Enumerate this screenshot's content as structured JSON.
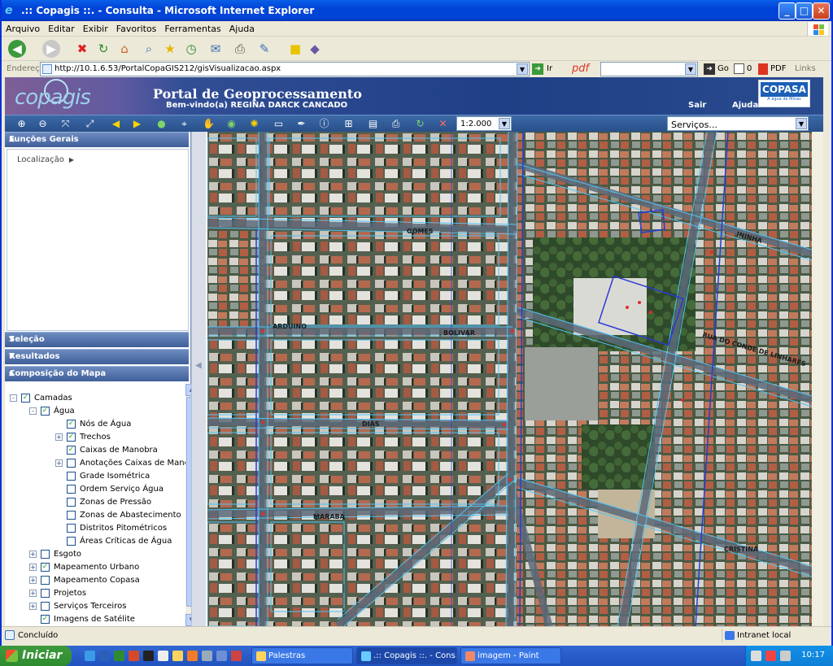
{
  "window": {
    "title": ".:: Copagis ::. - Consulta - Microsoft Internet Explorer",
    "minimize_label": "_",
    "maximize_label": "□",
    "close_label": "✕"
  },
  "menu": {
    "items": [
      "Arquivo",
      "Editar",
      "Exibir",
      "Favoritos",
      "Ferramentas",
      "Ajuda"
    ]
  },
  "address": {
    "label": "Endereço",
    "url": "http://10.1.6.53/PortalCopaGIS212/gisVisualizacao.aspx",
    "go_label": "Ir",
    "pdf_label": "pdf",
    "go2_label": "Go",
    "count": "0",
    "pdf2_label": "PDF",
    "links_label": "Links"
  },
  "banner": {
    "logo_text": "copagis",
    "title": "Portal de Geoprocessamento",
    "welcome": "Bem-vindo(a) REGINA DARCK CANCADO",
    "sair": "Sair",
    "ajuda": "Ajuda",
    "brand": "COPASA",
    "brand_tagline": "A água de Minas"
  },
  "map_toolbar": {
    "scale_value": "1:2.000",
    "servicos_value": "Serviços..."
  },
  "panels": {
    "funcoes_gerais": "Funções Gerais",
    "localizacao": "Localização",
    "selecao": "Seleção",
    "resultados": "Resultados",
    "composicao": "Composição do Mapa"
  },
  "tree": [
    {
      "label": "Camadas",
      "checked": true,
      "level": 0,
      "expander": "-"
    },
    {
      "label": "Água",
      "checked": true,
      "level": 1,
      "expander": "-"
    },
    {
      "label": "Nós de Água",
      "checked": true,
      "level": 2,
      "expander": ""
    },
    {
      "label": "Trechos",
      "checked": true,
      "level": 2,
      "expander": "+"
    },
    {
      "label": "Caixas de Manobra",
      "checked": true,
      "level": 2,
      "expander": ""
    },
    {
      "label": "Anotações Caixas de Manobra",
      "checked": false,
      "level": 2,
      "expander": "+"
    },
    {
      "label": "Grade Isométrica",
      "checked": false,
      "level": 2,
      "expander": ""
    },
    {
      "label": "Ordem Serviço Água",
      "checked": false,
      "level": 2,
      "expander": ""
    },
    {
      "label": "Zonas de Pressão",
      "checked": false,
      "level": 2,
      "expander": ""
    },
    {
      "label": "Zonas de Abastecimento",
      "checked": false,
      "level": 2,
      "expander": ""
    },
    {
      "label": "Distritos Pitométricos",
      "checked": false,
      "level": 2,
      "expander": ""
    },
    {
      "label": "Áreas Críticas de Água",
      "checked": false,
      "level": 2,
      "expander": ""
    },
    {
      "label": "Esgoto",
      "checked": false,
      "level": 1,
      "expander": "+"
    },
    {
      "label": "Mapeamento Urbano",
      "checked": true,
      "level": 1,
      "expander": "+"
    },
    {
      "label": "Mapeamento Copasa",
      "checked": false,
      "level": 1,
      "expander": "+"
    },
    {
      "label": "Projetos",
      "checked": false,
      "level": 1,
      "expander": "+"
    },
    {
      "label": "Serviços Terceiros",
      "checked": false,
      "level": 1,
      "expander": "+"
    },
    {
      "label": "Imagens de Satélite",
      "checked": true,
      "level": 1,
      "expander": ""
    }
  ],
  "map_labels": {
    "gomes": "GOMES",
    "arduino": "ARDUINO",
    "bolivar": "BOLIVAR",
    "dias": "DIAS",
    "maraba": "MARABA",
    "cristina": "CRISTINA",
    "conde": "RUA DO CONDE DE LINHARES",
    "ninha": "ININHA"
  },
  "status": {
    "text": "Concluído",
    "zone": "Intranet local"
  },
  "taskbar": {
    "start": "Iniciar",
    "tasks": [
      "Palestras",
      ".:: Copagis ::. - Cons...",
      "imagem - Paint"
    ],
    "time": "10:17"
  },
  "colors": {
    "banner_blue": "#1f3f86",
    "panel_header": "#4f6da6",
    "map_line": "#4fc3f7"
  }
}
